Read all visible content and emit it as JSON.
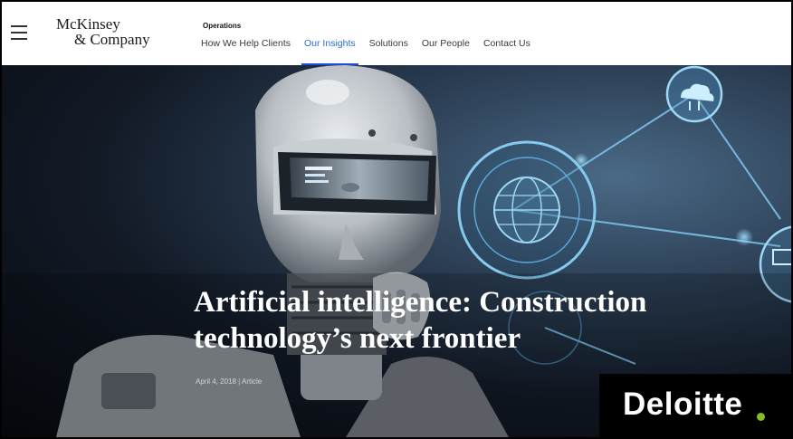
{
  "header": {
    "logo_line1": "McKinsey",
    "logo_line2": "& Company",
    "section_label": "Operations",
    "nav": [
      {
        "label": "How We Help Clients",
        "active": false
      },
      {
        "label": "Our Insights",
        "active": true
      },
      {
        "label": "Solutions",
        "active": false
      },
      {
        "label": "Our People",
        "active": false
      },
      {
        "label": "Contact Us",
        "active": false
      }
    ]
  },
  "hero": {
    "headline_line1": "Artificial intelligence: Construction",
    "headline_line2": "technology’s next frontier",
    "meta": "April 4, 2018 | Article"
  },
  "overlay": {
    "logo_text": "Deloitte",
    "accent_color": "#86bc25"
  },
  "colors": {
    "nav_active": "#2b6cd9",
    "nav_underline": "#1f4fd8"
  }
}
